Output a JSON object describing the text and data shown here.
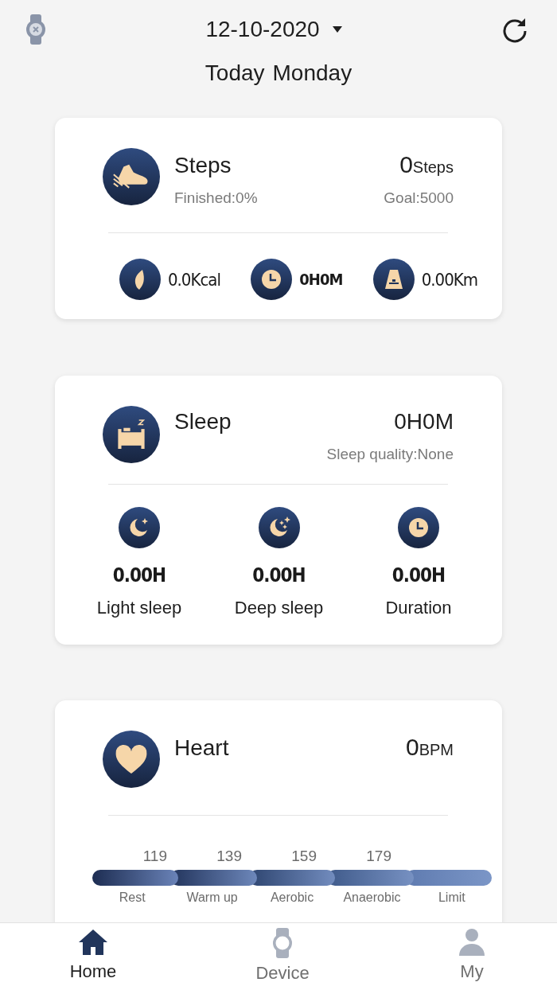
{
  "header": {
    "date": "12-10-2020",
    "day_label": "Today",
    "weekday": "Monday"
  },
  "steps_card": {
    "title": "Steps",
    "value": "0",
    "unit": "Steps",
    "finished": "Finished:0%",
    "goal": "Goal:5000",
    "stats": [
      {
        "kind": "calories",
        "value": "0.0Kcal"
      },
      {
        "kind": "time",
        "value": "0H0M"
      },
      {
        "kind": "distance",
        "value": "0.00Km"
      }
    ]
  },
  "sleep_card": {
    "title": "Sleep",
    "value": "0H0M",
    "quality": "Sleep quality:None",
    "stats": [
      {
        "kind": "light",
        "value": "0.00H",
        "label": "Light sleep"
      },
      {
        "kind": "deep",
        "value": "0.00H",
        "label": "Deep sleep"
      },
      {
        "kind": "duration",
        "value": "0.00H",
        "label": "Duration"
      }
    ]
  },
  "heart_card": {
    "title": "Heart",
    "value": "0",
    "unit": "BPM",
    "thresholds": [
      "119",
      "139",
      "159",
      "179"
    ],
    "zones": [
      "Rest",
      "Warm up",
      "Aerobic",
      "Anaerobic",
      "Limit"
    ]
  },
  "tab_bar": [
    {
      "kind": "home",
      "label": "Home",
      "selected": true
    },
    {
      "kind": "device",
      "label": "Device",
      "selected": false
    },
    {
      "kind": "profile",
      "label": "My",
      "selected": false
    }
  ]
}
